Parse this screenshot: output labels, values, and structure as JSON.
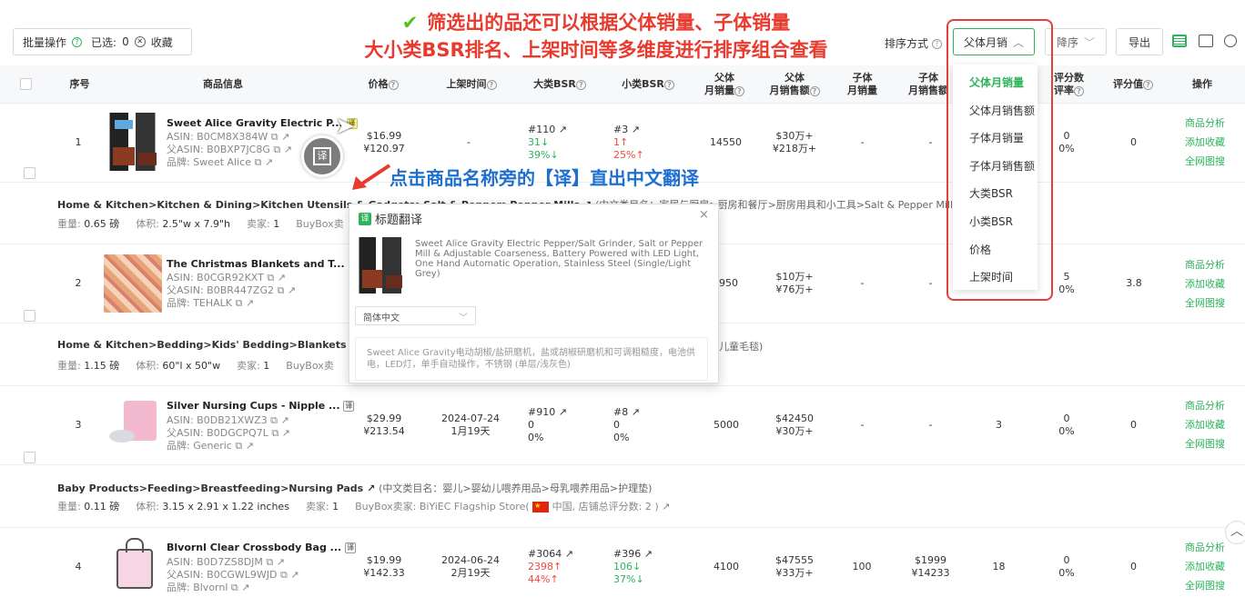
{
  "toolbar": {
    "batch_label": "批量操作",
    "selected_label": "已选:",
    "selected_count": "0",
    "favorite_label": "收藏",
    "sort_label": "排序方式",
    "sort_value": "父体月销",
    "order_value": "降序",
    "export_label": "导出"
  },
  "annotations": {
    "top_line1": "筛选出的品还可以根据父体销量、子体销量",
    "top_line2": "大小类BSR排名、上架时间等多维度进行排序组合查看",
    "translate_hint": "点击商品名称旁的【译】直出中文翻译"
  },
  "headers": {
    "index": "序号",
    "product": "商品信息",
    "price": "价格",
    "listed": "上架时间",
    "big_bsr": "大类BSR",
    "small_bsr": "小类BSR",
    "parent_sales_1": "父体",
    "parent_sales_2": "月销量",
    "parent_rev_1": "父体",
    "parent_rev_2": "月销售额",
    "child_sales_1": "子体",
    "child_sales_2": "月销量",
    "child_rev_1": "子体",
    "child_rev_2": "月销售额",
    "review_rate_1": "评分数",
    "review_rate_2": "评率",
    "rating": "评分值",
    "ops": "操作"
  },
  "sort_dropdown": [
    "父体月销量",
    "父体月销售额",
    "子体月销量",
    "子体月销售额",
    "大类BSR",
    "小类BSR",
    "价格",
    "上架时间"
  ],
  "ops_labels": {
    "analysis": "商品分析",
    "fav": "添加收藏",
    "web": "全网图搜"
  },
  "products": [
    {
      "index": "1",
      "name": "Sweet Alice Gravity Electric P...",
      "asin": "ASIN:  B0CM8X384W",
      "parent_asin": "父ASIN:  B0BXP7JC8G",
      "brand": "品牌:  Sweet Alice",
      "price_usd": "$16.99",
      "price_cny": "¥120.97",
      "listed": "-",
      "listed_ago": "",
      "big_bsr": "#110",
      "big_delta": "31↓",
      "big_pct": "39%↓",
      "small_bsr": "#3",
      "small_delta": "1↑",
      "small_pct": "25%↑",
      "parent_sales": "14550",
      "parent_rev_usd": "$30万+",
      "parent_rev_cny": "¥218万+",
      "child_sales": "-",
      "child_rev": "-",
      "reviews": "",
      "review_rate": "0",
      "review_pct": "0%",
      "rating": "0",
      "category": "Home & Kitchen>Kitchen & Dining>Kitchen Utensils & Gadgets>Salt & Pepper>Pepper Mills",
      "category_cn": "(中文类目名：家居与厨房>厨房和餐厅>厨房用具和小工具>Salt & Pepper Mills、Shakers 和",
      "weight": "0.65 磅",
      "volume": "2.5\"w x 7.9\"h",
      "sellers": "1",
      "buybox": "BuyBox卖"
    },
    {
      "index": "2",
      "name": "The Christmas Blankets and T...",
      "asin": "ASIN:  B0CGR92KXT",
      "parent_asin": "父ASIN:  B0BR447ZG2",
      "brand": "品牌:  TEHALK",
      "price_usd": "",
      "price_cny": "",
      "listed": "",
      "listed_ago": "",
      "big_bsr": "",
      "big_delta": "",
      "big_pct": "",
      "small_bsr": "",
      "small_delta": "",
      "small_pct": "",
      "parent_sales": "950",
      "parent_rev_usd": "$10万+",
      "parent_rev_cny": "¥76万+",
      "child_sales": "-",
      "child_rev": "-",
      "reviews": "",
      "review_rate": "5",
      "review_pct": "0%",
      "rating": "3.8",
      "category": "Home & Kitchen>Bedding>Kids' Bedding>Blankets & Thro",
      "category_cn": "儿童毛毯)",
      "weight": "1.15 磅",
      "volume": "60\"l x 50\"w",
      "sellers": "1",
      "buybox": "BuyBox卖"
    },
    {
      "index": "3",
      "name": "Silver Nursing Cups - Nipple ...",
      "asin": "ASIN:  B0DB21XWZ3",
      "parent_asin": "父ASIN:  B0DGCPQ7L",
      "brand": "品牌:  Generic",
      "price_usd": "$29.99",
      "price_cny": "¥213.54",
      "listed": "2024-07-24",
      "listed_ago": "1月19天",
      "big_bsr": "#910",
      "big_delta": "0",
      "big_pct": "0%",
      "small_bsr": "#8",
      "small_delta": "0",
      "small_pct": "0%",
      "parent_sales": "5000",
      "parent_rev_usd": "$42450",
      "parent_rev_cny": "¥30万+",
      "child_sales": "-",
      "child_rev": "-",
      "reviews": "3",
      "review_rate": "0",
      "review_pct": "0%",
      "rating": "0",
      "category": "Baby Products>Feeding>Breastfeeding>Nursing Pads",
      "category_cn": "(中文类目名：婴儿>婴幼儿喂养用品>母乳喂养用品>护理垫)",
      "weight": "0.11 磅",
      "volume": "3.15 x 2.91 x 1.22 inches",
      "sellers": "1",
      "buybox": "BuyBox卖家:  BiYiEC Flagship Store(",
      "buybox_country": "中国, 店铺总评分数: 2 )"
    },
    {
      "index": "4",
      "name": "Blvornl Clear Crossbody Bag ...",
      "asin": "ASIN:  B0D7ZS8DJM",
      "parent_asin": "父ASIN:  B0CGWL9WJD",
      "brand": "品牌:  Blvornl",
      "price_usd": "$19.99",
      "price_cny": "¥142.33",
      "listed": "2024-06-24",
      "listed_ago": "2月19天",
      "big_bsr": "#3064",
      "big_delta": "2398↑",
      "big_pct": "44%↑",
      "small_bsr": "#396",
      "small_delta": "106↓",
      "small_pct": "37%↓",
      "parent_sales": "4100",
      "parent_rev_usd": "$47555",
      "parent_rev_cny": "¥33万+",
      "child_sales": "100",
      "child_rev_usd": "$1999",
      "child_rev_cny": "¥14233",
      "reviews": "18",
      "review_rate": "0",
      "review_pct": "0%",
      "rating": "0"
    }
  ],
  "popup": {
    "title": "标题翻译",
    "original": "Sweet Alice Gravity Electric Pepper/Salt Grinder, Salt or Pepper Mill & Adjustable Coarseness, Battery Powered with LED Light, One Hand Automatic Operation, Stainless Steel (Single/Light Grey)",
    "language": "简体中文",
    "translation": "Sweet Alice Gravity电动胡椒/盐研磨机，盐或胡椒研磨机和可调粗糙度，电池供电，LED灯，单手自动操作，不锈钢 (单层/浅灰色)"
  },
  "translate_badge": "译",
  "colors": {
    "accent": "#2db35a",
    "red_annotation": "#e83b2e",
    "blue_annotation": "#1f6fd1",
    "dropdown_border": "#e0413a"
  }
}
